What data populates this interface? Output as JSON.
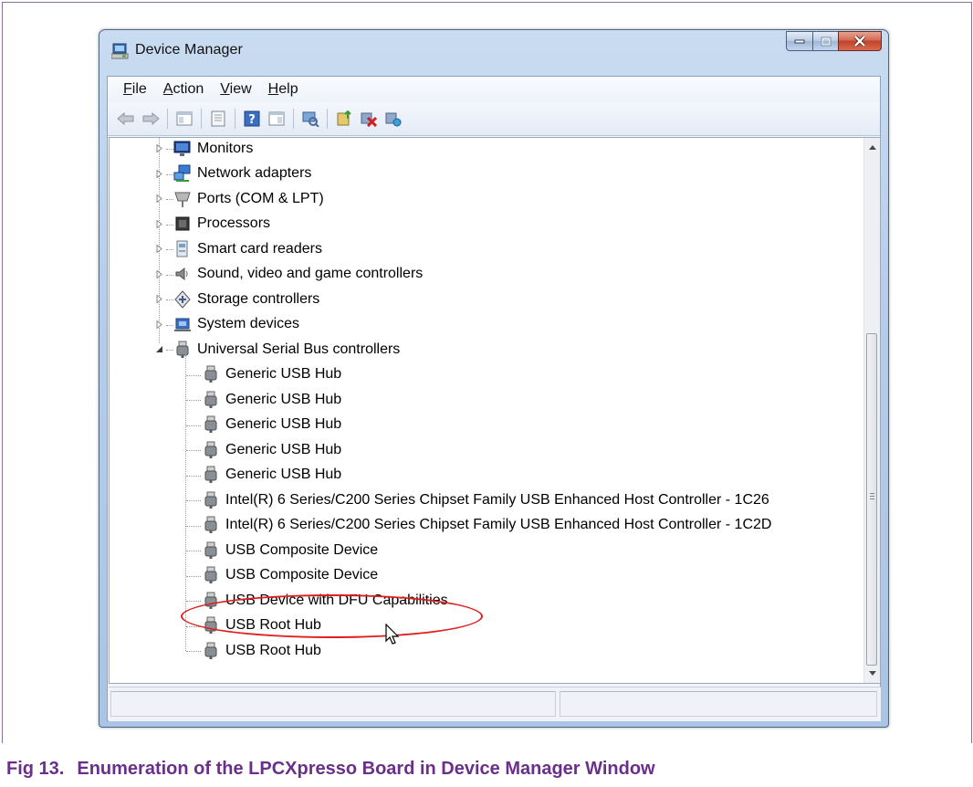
{
  "window": {
    "title": "Device Manager"
  },
  "menu": [
    {
      "label": "File"
    },
    {
      "label": "Action"
    },
    {
      "label": "View"
    },
    {
      "label": "Help"
    }
  ],
  "toolbar": {
    "buttons": [
      {
        "icon": "back-arrow-icon"
      },
      {
        "icon": "forward-arrow-icon"
      },
      {
        "icon": "show-hide-console-tree-icon"
      },
      {
        "icon": "properties-icon"
      },
      {
        "icon": "help-icon"
      },
      {
        "icon": "action-pane-icon"
      },
      {
        "icon": "scan-hardware-changes-icon"
      },
      {
        "icon": "update-driver-icon"
      },
      {
        "icon": "uninstall-icon"
      },
      {
        "icon": "enable-device-icon"
      }
    ]
  },
  "tree": {
    "categories": [
      {
        "label": "Monitors",
        "icon": "monitor-icon",
        "expanded": false
      },
      {
        "label": "Network adapters",
        "icon": "network-adapter-icon",
        "expanded": false
      },
      {
        "label": "Ports (COM & LPT)",
        "icon": "port-icon",
        "expanded": false
      },
      {
        "label": "Processors",
        "icon": "processor-icon",
        "expanded": false
      },
      {
        "label": "Smart card readers",
        "icon": "smart-card-reader-icon",
        "expanded": false
      },
      {
        "label": "Sound, video and game controllers",
        "icon": "speaker-icon",
        "expanded": false
      },
      {
        "label": "Storage controllers",
        "icon": "storage-controller-icon",
        "expanded": false
      },
      {
        "label": "System devices",
        "icon": "system-device-icon",
        "expanded": false
      },
      {
        "label": "Universal Serial Bus controllers",
        "icon": "usb-icon",
        "expanded": true
      }
    ],
    "usb_children": [
      {
        "label": "Generic USB Hub"
      },
      {
        "label": "Generic USB Hub"
      },
      {
        "label": "Generic USB Hub"
      },
      {
        "label": "Generic USB Hub"
      },
      {
        "label": "Generic USB Hub"
      },
      {
        "label": "Intel(R) 6 Series/C200 Series Chipset Family USB Enhanced Host Controller - 1C26"
      },
      {
        "label": "Intel(R) 6 Series/C200 Series Chipset Family USB Enhanced Host Controller - 1C2D"
      },
      {
        "label": "USB Composite Device"
      },
      {
        "label": "USB Composite Device"
      },
      {
        "label": "USB Device with DFU Capabilities",
        "highlighted": true
      },
      {
        "label": "USB Root Hub"
      },
      {
        "label": "USB Root Hub"
      }
    ]
  },
  "figure": {
    "number": "Fig 13.",
    "caption": "Enumeration of the LPCXpresso Board in Device Manager Window"
  },
  "colors": {
    "caption": "#6a2f8a",
    "highlight_ellipse": "#e01e1e"
  }
}
